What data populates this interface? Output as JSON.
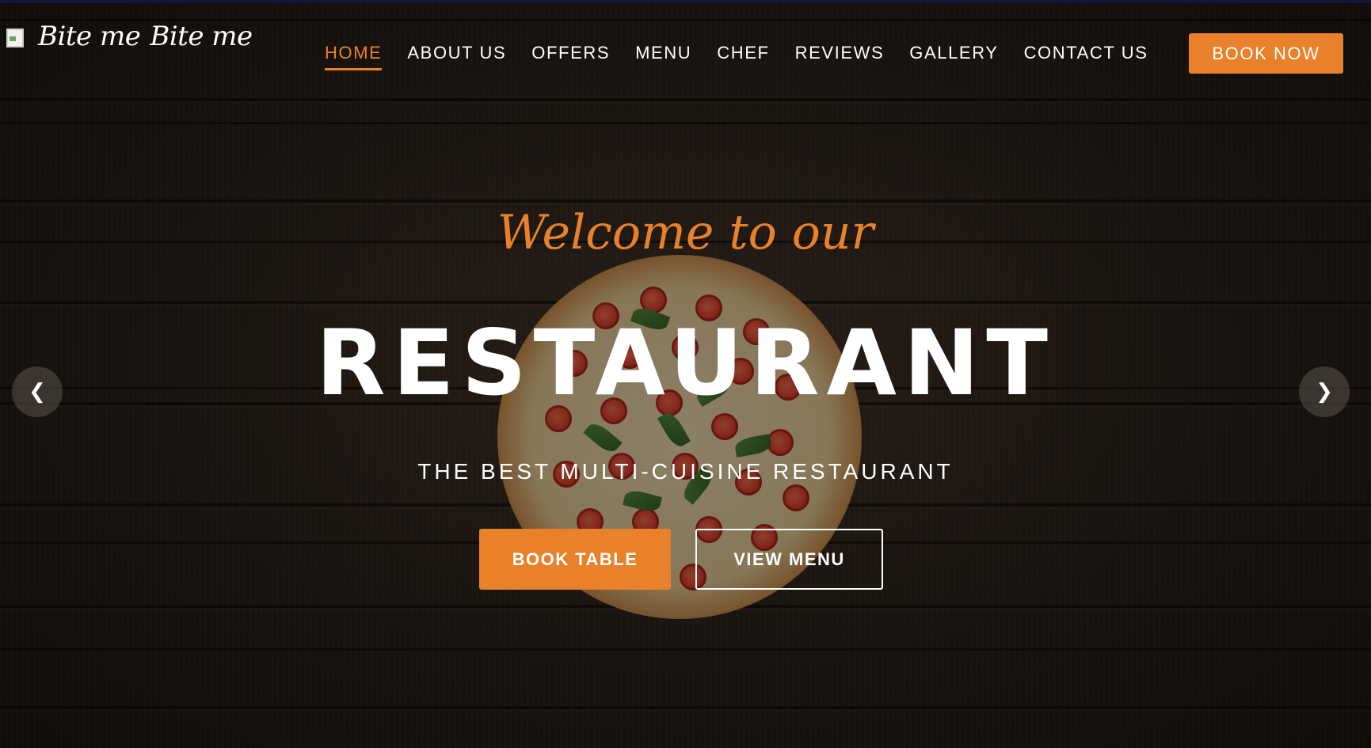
{
  "brand": {
    "logo_alt_text": "Bite me",
    "logo_text": "Bite me",
    "accent_color": "#e8812a"
  },
  "nav": {
    "items": [
      {
        "label": "HOME",
        "active": true
      },
      {
        "label": "ABOUT US",
        "active": false
      },
      {
        "label": "OFFERS",
        "active": false
      },
      {
        "label": "MENU",
        "active": false
      },
      {
        "label": "CHEF",
        "active": false
      },
      {
        "label": "REVIEWS",
        "active": false
      },
      {
        "label": "GALLERY",
        "active": false
      },
      {
        "label": "CONTACT US",
        "active": false
      }
    ],
    "book_now_label": "BOOK NOW"
  },
  "hero": {
    "welcome": "Welcome to our",
    "title": "RESTAURANT",
    "subtitle": "THE BEST MULTI-CUISINE RESTAURANT",
    "primary_button": "BOOK TABLE",
    "secondary_button": "VIEW MENU",
    "prev_icon": "chevron-left-icon",
    "next_icon": "chevron-right-icon",
    "prev_glyph": "❮",
    "next_glyph": "❯"
  }
}
